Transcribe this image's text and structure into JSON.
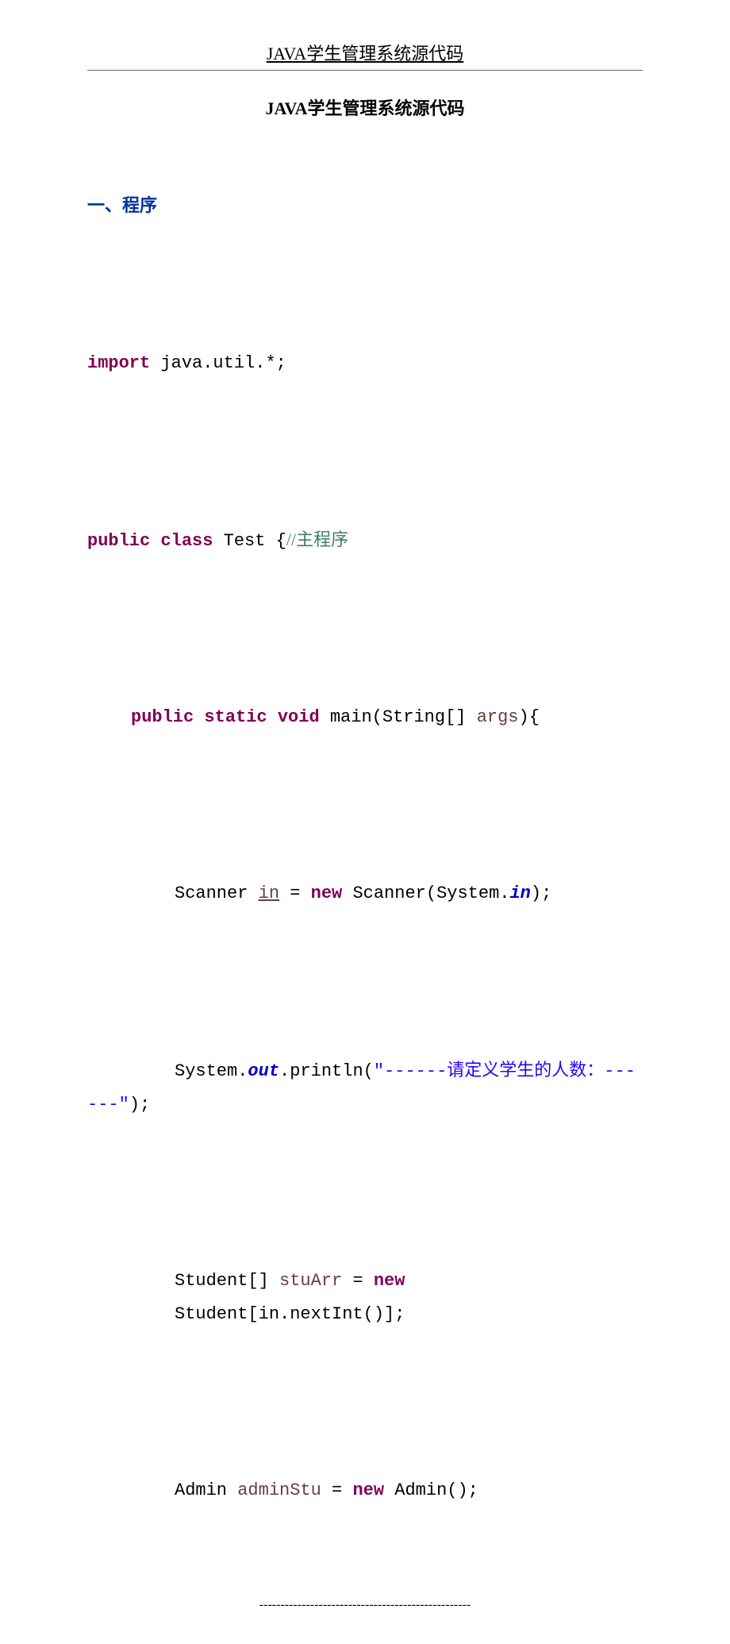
{
  "header": {
    "title": "JAVA学生管理系统源代码"
  },
  "doc_title": "JAVA学生管理系统源代码",
  "section_heading": "一、程序",
  "code": {
    "import_kw": "import",
    "import_rest": " java.util.*;",
    "cls_public": "public",
    "cls_class": "class",
    "cls_name": " Test {",
    "cls_comment": "//主程序",
    "m_public": "public",
    "m_static": "static",
    "m_void": "void",
    "m_name": " main(String[] ",
    "m_arg": "args",
    "m_close": "){",
    "sc_decl": "Scanner ",
    "sc_var": "in",
    "sc_eq": " = ",
    "sc_new": "new",
    "sc_ctor": " Scanner(System.",
    "sc_in": "in",
    "sc_end": ");",
    "print_sys": "System.",
    "print_out": "out",
    "print_mid": ".println(",
    "print_str1": "\"------",
    "print_str_cn": "请定义学生的人数：",
    "print_str2": "------\"",
    "print_end": ");",
    "stu_t": "Student[] ",
    "stu_var": "stuArr",
    "stu_eq": " = ",
    "stu_new": "new",
    "stu_rest": " Student[in.nextInt()];",
    "adm_t": "Admin ",
    "adm_var": "adminStu",
    "adm_eq": " = ",
    "adm_new": "new",
    "adm_rest": " Admin();"
  },
  "footer": "--------------------------------------------------"
}
